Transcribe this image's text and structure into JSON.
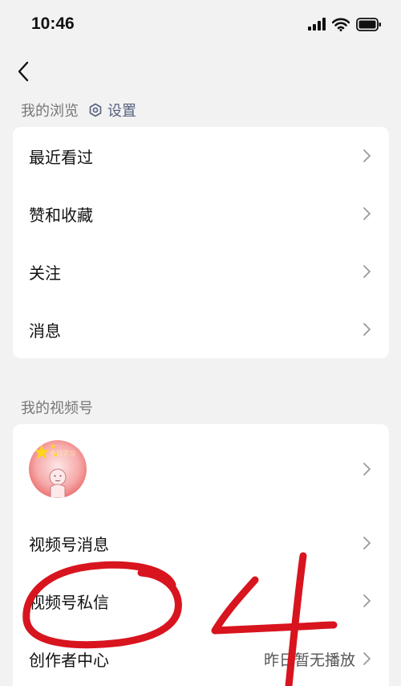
{
  "status_bar": {
    "time": "10:46"
  },
  "browse_section": {
    "title": "我的浏览",
    "settings_label": "设置",
    "items": [
      {
        "label": "最近看过"
      },
      {
        "label": "赞和收藏"
      },
      {
        "label": "关注"
      },
      {
        "label": "消息"
      }
    ]
  },
  "channel_section": {
    "title": "我的视频号",
    "avatar_text": "今日学习",
    "items": [
      {
        "label": "视频号消息"
      },
      {
        "label": "视频号私信"
      },
      {
        "label": "创作者中心",
        "extra": "昨日暂无播放"
      }
    ]
  },
  "colors": {
    "accent": "#56607f",
    "annotation": "#d8141e",
    "background": "#f2f2f2"
  },
  "icons": [
    "back-icon",
    "signal-icon",
    "wifi-icon",
    "battery-icon",
    "settings-icon",
    "chevron-right-icon"
  ]
}
